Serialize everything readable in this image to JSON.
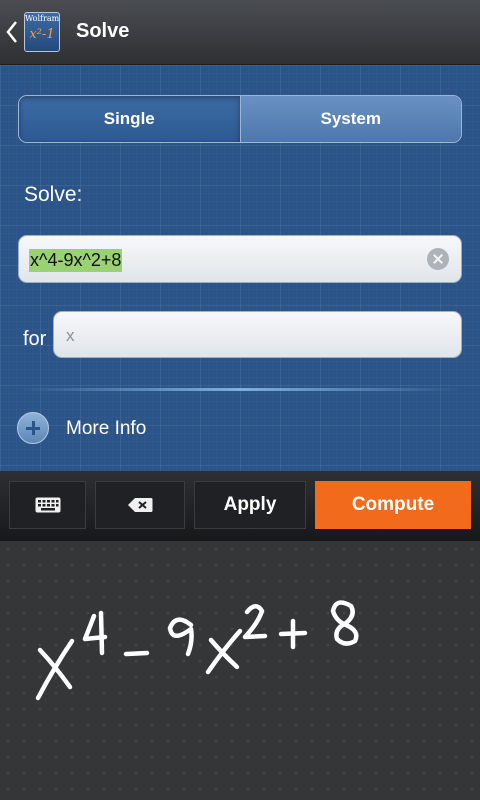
{
  "header": {
    "title": "Solve",
    "app_icon": {
      "brand": "Wolfram",
      "expression": "x²-1"
    }
  },
  "mode_toggle": {
    "options": [
      "Single",
      "System"
    ],
    "selected": "Single"
  },
  "solve_label": "Solve:",
  "expression_input": {
    "value": "x^4-9x^2+8"
  },
  "variable_field": {
    "label": "for",
    "placeholder": "x",
    "value": ""
  },
  "more_info_label": "More Info",
  "toolbar": {
    "keyboard_icon": "keyboard-icon",
    "backspace_icon": "backspace-icon",
    "apply_label": "Apply",
    "compute_label": "Compute"
  },
  "handwriting": {
    "recognized": "x^4 - 9x^2 + 8"
  },
  "colors": {
    "accent": "#f26b1d",
    "content_bg": "#2b5489",
    "selection_highlight": "#9ad172"
  }
}
